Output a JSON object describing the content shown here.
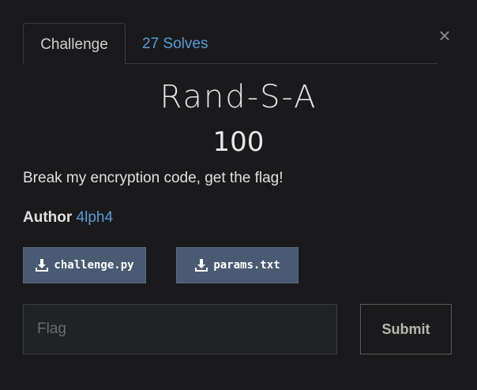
{
  "modal": {
    "close_label": "×"
  },
  "tabs": [
    {
      "label": "Challenge",
      "active": true
    },
    {
      "label": "27 Solves",
      "active": false
    }
  ],
  "challenge": {
    "name": "Rand-S-A",
    "points": "100",
    "description": "Break my encryption code, get the flag!",
    "author_label": "Author",
    "author_name": "4lph4"
  },
  "files": [
    {
      "name": "challenge.py",
      "icon": "download-icon"
    },
    {
      "name": "params.txt",
      "icon": "download-icon"
    }
  ],
  "submission": {
    "placeholder": "Flag",
    "value": "",
    "submit_label": "Submit"
  },
  "colors": {
    "background": "#1a1a1c",
    "link": "#5b9bd5",
    "file_button": "#4a5a73"
  }
}
